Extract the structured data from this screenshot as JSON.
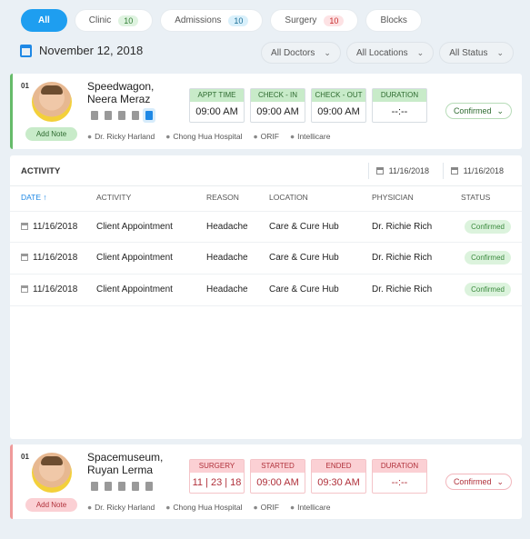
{
  "tabs": [
    {
      "label": "All",
      "count": null
    },
    {
      "label": "Clinic",
      "count": "10"
    },
    {
      "label": "Admissions",
      "count": "10"
    },
    {
      "label": "Surgery",
      "count": "10"
    },
    {
      "label": "Blocks",
      "count": null
    }
  ],
  "date": "November 12, 2018",
  "filters": [
    "All Doctors",
    "All Locations",
    "All Status"
  ],
  "appointment": {
    "index": "01",
    "name_line1": "Speedwagon,",
    "name_line2": "Neera Meraz",
    "note_label": "Add Note",
    "doctor": "Dr. Ricky Harland",
    "location": "Chong Hua Hospital",
    "procedure": "ORIF",
    "insurance": "Intellicare",
    "boxes": [
      {
        "label": "APPT TIME",
        "value": "09:00 AM"
      },
      {
        "label": "CHECK - IN",
        "value": "09:00 AM"
      },
      {
        "label": "CHECK - OUT",
        "value": "09:00 AM"
      },
      {
        "label": "DURATION",
        "value": "--:--"
      }
    ],
    "status": "Confirmed"
  },
  "activity": {
    "title": "ACTIVITY",
    "from": "11/16/2018",
    "to": "11/16/2018",
    "headers": {
      "date": "DATE",
      "activity": "ACTIVITY",
      "reason": "REASON",
      "location": "LOCATION",
      "physician": "PHYSICIAN",
      "status": "STATUS"
    },
    "rows": [
      {
        "date": "11/16/2018",
        "activity": "Client Appointment",
        "reason": "Headache",
        "location": "Care & Cure Hub",
        "physician": "Dr. Richie Rich",
        "status": "Confirmed"
      },
      {
        "date": "11/16/2018",
        "activity": "Client Appointment",
        "reason": "Headache",
        "location": "Care & Cure Hub",
        "physician": "Dr. Richie Rich",
        "status": "Confirmed"
      },
      {
        "date": "11/16/2018",
        "activity": "Client Appointment",
        "reason": "Headache",
        "location": "Care & Cure Hub",
        "physician": "Dr. Richie Rich",
        "status": "Confirmed"
      }
    ]
  },
  "surgery": {
    "index": "01",
    "name_line1": "Spacemuseum,",
    "name_line2": "Ruyan Lerma",
    "note_label": "Add Note",
    "doctor": "Dr. Ricky Harland",
    "location": "Chong Hua Hospital",
    "procedure": "ORIF",
    "insurance": "Intellicare",
    "boxes": [
      {
        "label": "SURGERY",
        "value": "11 | 23 | 18"
      },
      {
        "label": "STARTED",
        "value": "09:00 AM"
      },
      {
        "label": "ENDED",
        "value": "09:30 AM"
      },
      {
        "label": "DURATION",
        "value": "--:--"
      }
    ],
    "status": "Confirmed"
  }
}
